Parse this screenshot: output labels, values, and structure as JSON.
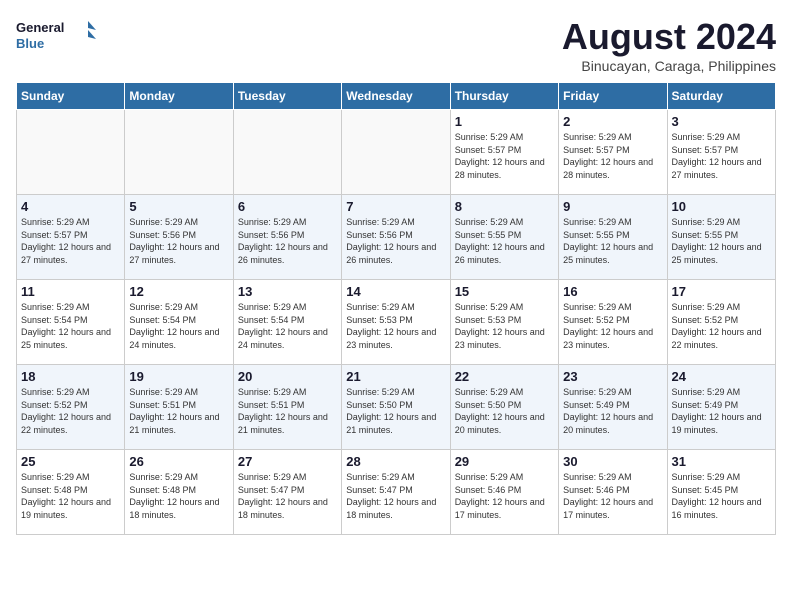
{
  "header": {
    "logo_line1": "General",
    "logo_line2": "Blue",
    "month_title": "August 2024",
    "location": "Binucayan, Caraga, Philippines"
  },
  "days_of_week": [
    "Sunday",
    "Monday",
    "Tuesday",
    "Wednesday",
    "Thursday",
    "Friday",
    "Saturday"
  ],
  "weeks": [
    [
      {
        "day": "",
        "sunrise": "",
        "sunset": "",
        "daylight": ""
      },
      {
        "day": "",
        "sunrise": "",
        "sunset": "",
        "daylight": ""
      },
      {
        "day": "",
        "sunrise": "",
        "sunset": "",
        "daylight": ""
      },
      {
        "day": "",
        "sunrise": "",
        "sunset": "",
        "daylight": ""
      },
      {
        "day": "1",
        "sunrise": "5:29 AM",
        "sunset": "5:57 PM",
        "daylight": "12 hours and 28 minutes."
      },
      {
        "day": "2",
        "sunrise": "5:29 AM",
        "sunset": "5:57 PM",
        "daylight": "12 hours and 28 minutes."
      },
      {
        "day": "3",
        "sunrise": "5:29 AM",
        "sunset": "5:57 PM",
        "daylight": "12 hours and 27 minutes."
      }
    ],
    [
      {
        "day": "4",
        "sunrise": "5:29 AM",
        "sunset": "5:57 PM",
        "daylight": "12 hours and 27 minutes."
      },
      {
        "day": "5",
        "sunrise": "5:29 AM",
        "sunset": "5:56 PM",
        "daylight": "12 hours and 27 minutes."
      },
      {
        "day": "6",
        "sunrise": "5:29 AM",
        "sunset": "5:56 PM",
        "daylight": "12 hours and 26 minutes."
      },
      {
        "day": "7",
        "sunrise": "5:29 AM",
        "sunset": "5:56 PM",
        "daylight": "12 hours and 26 minutes."
      },
      {
        "day": "8",
        "sunrise": "5:29 AM",
        "sunset": "5:55 PM",
        "daylight": "12 hours and 26 minutes."
      },
      {
        "day": "9",
        "sunrise": "5:29 AM",
        "sunset": "5:55 PM",
        "daylight": "12 hours and 25 minutes."
      },
      {
        "day": "10",
        "sunrise": "5:29 AM",
        "sunset": "5:55 PM",
        "daylight": "12 hours and 25 minutes."
      }
    ],
    [
      {
        "day": "11",
        "sunrise": "5:29 AM",
        "sunset": "5:54 PM",
        "daylight": "12 hours and 25 minutes."
      },
      {
        "day": "12",
        "sunrise": "5:29 AM",
        "sunset": "5:54 PM",
        "daylight": "12 hours and 24 minutes."
      },
      {
        "day": "13",
        "sunrise": "5:29 AM",
        "sunset": "5:54 PM",
        "daylight": "12 hours and 24 minutes."
      },
      {
        "day": "14",
        "sunrise": "5:29 AM",
        "sunset": "5:53 PM",
        "daylight": "12 hours and 23 minutes."
      },
      {
        "day": "15",
        "sunrise": "5:29 AM",
        "sunset": "5:53 PM",
        "daylight": "12 hours and 23 minutes."
      },
      {
        "day": "16",
        "sunrise": "5:29 AM",
        "sunset": "5:52 PM",
        "daylight": "12 hours and 23 minutes."
      },
      {
        "day": "17",
        "sunrise": "5:29 AM",
        "sunset": "5:52 PM",
        "daylight": "12 hours and 22 minutes."
      }
    ],
    [
      {
        "day": "18",
        "sunrise": "5:29 AM",
        "sunset": "5:52 PM",
        "daylight": "12 hours and 22 minutes."
      },
      {
        "day": "19",
        "sunrise": "5:29 AM",
        "sunset": "5:51 PM",
        "daylight": "12 hours and 21 minutes."
      },
      {
        "day": "20",
        "sunrise": "5:29 AM",
        "sunset": "5:51 PM",
        "daylight": "12 hours and 21 minutes."
      },
      {
        "day": "21",
        "sunrise": "5:29 AM",
        "sunset": "5:50 PM",
        "daylight": "12 hours and 21 minutes."
      },
      {
        "day": "22",
        "sunrise": "5:29 AM",
        "sunset": "5:50 PM",
        "daylight": "12 hours and 20 minutes."
      },
      {
        "day": "23",
        "sunrise": "5:29 AM",
        "sunset": "5:49 PM",
        "daylight": "12 hours and 20 minutes."
      },
      {
        "day": "24",
        "sunrise": "5:29 AM",
        "sunset": "5:49 PM",
        "daylight": "12 hours and 19 minutes."
      }
    ],
    [
      {
        "day": "25",
        "sunrise": "5:29 AM",
        "sunset": "5:48 PM",
        "daylight": "12 hours and 19 minutes."
      },
      {
        "day": "26",
        "sunrise": "5:29 AM",
        "sunset": "5:48 PM",
        "daylight": "12 hours and 18 minutes."
      },
      {
        "day": "27",
        "sunrise": "5:29 AM",
        "sunset": "5:47 PM",
        "daylight": "12 hours and 18 minutes."
      },
      {
        "day": "28",
        "sunrise": "5:29 AM",
        "sunset": "5:47 PM",
        "daylight": "12 hours and 18 minutes."
      },
      {
        "day": "29",
        "sunrise": "5:29 AM",
        "sunset": "5:46 PM",
        "daylight": "12 hours and 17 minutes."
      },
      {
        "day": "30",
        "sunrise": "5:29 AM",
        "sunset": "5:46 PM",
        "daylight": "12 hours and 17 minutes."
      },
      {
        "day": "31",
        "sunrise": "5:29 AM",
        "sunset": "5:45 PM",
        "daylight": "12 hours and 16 minutes."
      }
    ]
  ]
}
